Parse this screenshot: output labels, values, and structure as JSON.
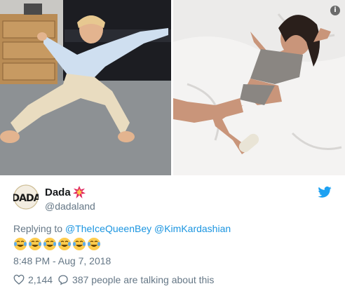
{
  "tweet": {
    "author": {
      "display_name": "Dada",
      "handle": "@dadaland",
      "avatar_text": "DADA",
      "name_emoji": "collision-icon"
    },
    "reply_prefix": "Replying to",
    "reply_mentions": [
      "@TheIceQueenBey",
      "@KimKardashian"
    ],
    "emojis": [
      "face-with-tears-of-joy-icon",
      "face-with-tears-of-joy-icon",
      "face-with-tears-of-joy-icon",
      "face-with-tears-of-joy-icon",
      "face-with-tears-of-joy-icon",
      "face-with-tears-of-joy-icon"
    ],
    "timestamp": "8:48 PM - Aug 7, 2018",
    "likes": "2,144",
    "talking": "387 people are talking about this"
  },
  "colors": {
    "link": "#1b95e0",
    "muted": "#657786",
    "twitter_blue": "#1da1f2",
    "like_red": "#e0245e"
  }
}
